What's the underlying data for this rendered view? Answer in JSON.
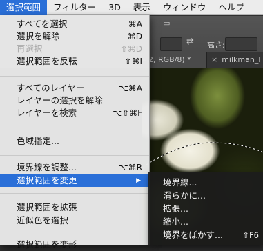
{
  "menubar": {
    "items": [
      {
        "label": "選択範囲",
        "active": true
      },
      {
        "label": "フィルター"
      },
      {
        "label": "3D"
      },
      {
        "label": "表示"
      },
      {
        "label": "ウィンドウ"
      },
      {
        "label": "ヘルプ"
      }
    ]
  },
  "toolbar": {
    "height_label": "高さ:"
  },
  "tabs": [
    {
      "label": "– 2, RGB/8) *"
    },
    {
      "close": "×",
      "label": "milkman_l"
    }
  ],
  "menu": {
    "items": [
      {
        "label": "すべてを選択",
        "shortcut": "⌘A"
      },
      {
        "label": "選択を解除",
        "shortcut": "⌘D"
      },
      {
        "label": "再選択",
        "shortcut": "⇧⌘D",
        "disabled": true
      },
      {
        "label": "選択範囲を反転",
        "shortcut": "⇧⌘I"
      },
      {
        "label": "すべてのレイヤー",
        "shortcut": "⌥⌘A"
      },
      {
        "label": "レイヤーの選択を解除",
        "shortcut": ""
      },
      {
        "label": "レイヤーを検索",
        "shortcut": "⌥⇧⌘F"
      },
      {
        "label": "色域指定...",
        "shortcut": ""
      },
      {
        "label": "境界線を調整...",
        "shortcut": "⌥⌘R"
      },
      {
        "label": "選択範囲を変更",
        "shortcut": "",
        "submenu": true,
        "highlighted": true
      },
      {
        "label": "選択範囲を拡張",
        "shortcut": ""
      },
      {
        "label": "近似色を選択",
        "shortcut": ""
      },
      {
        "label": "選択範囲を変形",
        "shortcut": ""
      }
    ]
  },
  "submenu": {
    "items": [
      {
        "label": "境界線...",
        "shortcut": ""
      },
      {
        "label": "滑らかに...",
        "shortcut": ""
      },
      {
        "label": "拡張...",
        "shortcut": ""
      },
      {
        "label": "縮小...",
        "shortcut": ""
      },
      {
        "label": "境界をぼかす...",
        "shortcut": "⇧F6"
      }
    ]
  },
  "colors": {
    "highlight": "#2a6fd8",
    "menu_bg": "#eaeaea",
    "submenu_bg": "#1c1c1c"
  }
}
